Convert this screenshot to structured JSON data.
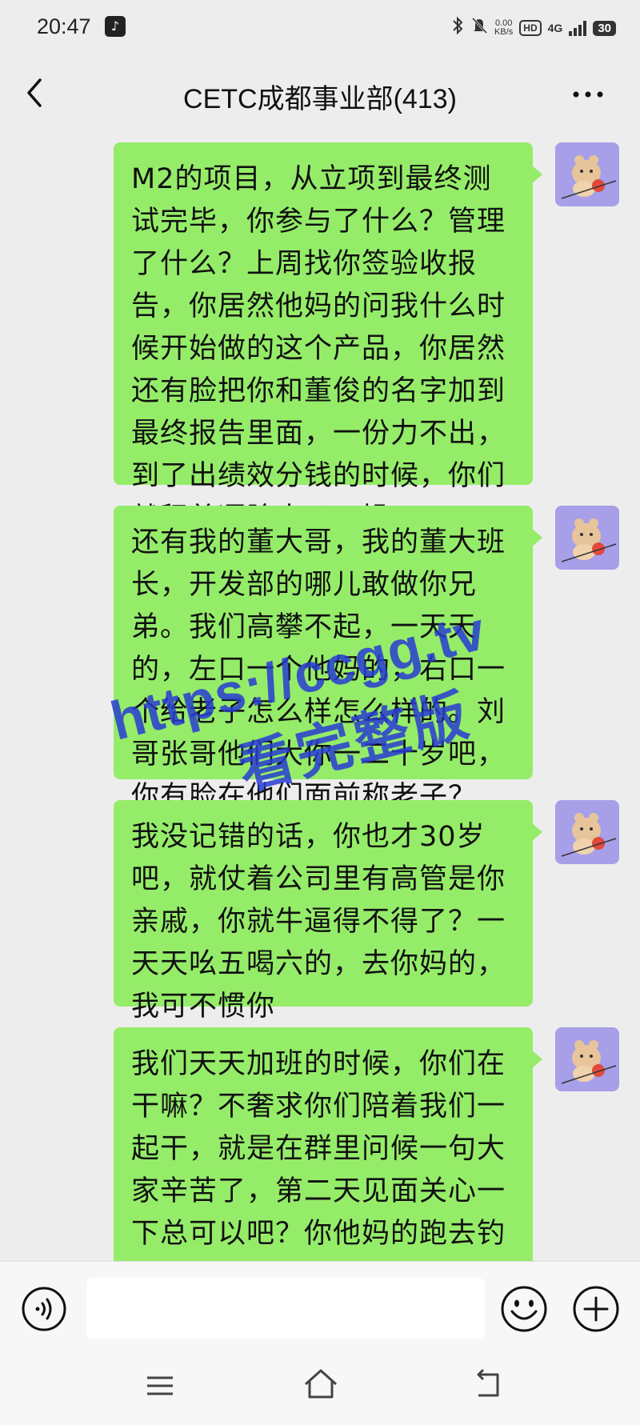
{
  "status_bar": {
    "time": "20:47",
    "app_glyph": "♪",
    "speed_value": "0.00",
    "speed_unit": "KB/s",
    "hd": "HD",
    "network": "4G",
    "battery": "30"
  },
  "header": {
    "title": "CETC成都事业部(413)"
  },
  "messages": [
    {
      "text": "M2的项目，从立项到最终测试完毕，你参与了什么？管理了什么？上周找你签验收报告，你居然他妈的问我什么时候开始做的这个产品，你居然还有脸把你和董俊的名字加到最终报告里面，一份力不出，到了出绩效分钱的时候，你们就舔着逼脸来了？操"
    },
    {
      "text": "还有我的董大哥，我的董大班长，开发部的哪儿敢做你兄弟。我们高攀不起，一天天的，左口一个他妈的，右口一个给老子怎么样怎么样的。刘哥张哥他们大你一二十岁吧，你有脸在他们面前称老子？"
    },
    {
      "text": "我没记错的话，你也才30岁吧，就仗着公司里有高管是你亲戚，你就牛逼得不得了？一天天吆五喝六的，去你妈的，我可不惯你"
    },
    {
      "text": "我们天天加班的时候，你们在干嘛？不奢求你们陪着我们一起干，就是在群里问候一句大家辛苦了，第二天见面关心一下总可以吧？你他妈的跑去钓鱼的时候，知不知道还有兄弟"
    }
  ],
  "watermark": {
    "url": "https://ccgg.tv",
    "text": "看完整版"
  },
  "input_bar": {
    "value": "",
    "placeholder": ""
  },
  "colors": {
    "bubble": "#95ec69",
    "background": "#ededed",
    "avatar_bg": "#a79fe8"
  }
}
